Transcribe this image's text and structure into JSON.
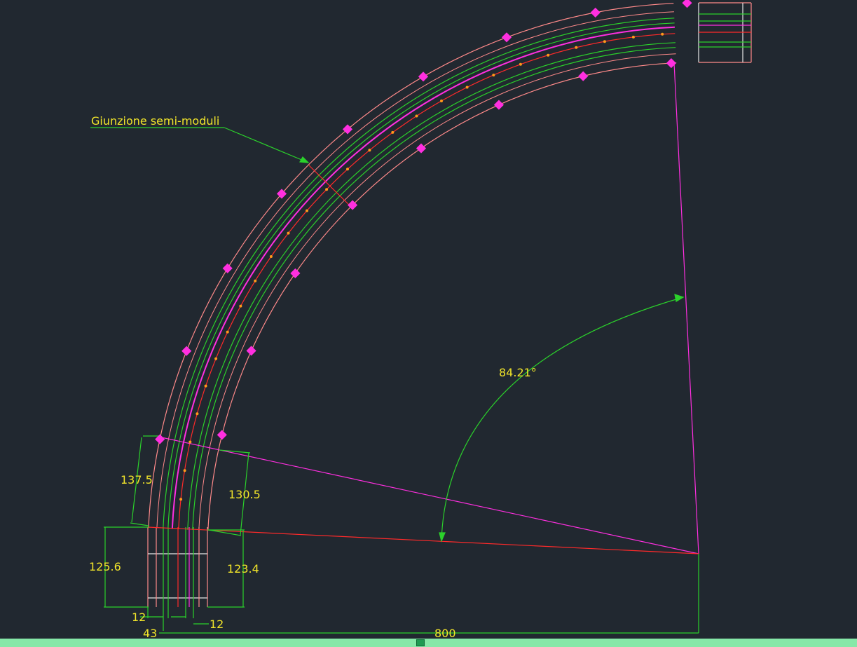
{
  "drawing": {
    "label_text": "Giunzione semi-moduli",
    "angle_label": "84.21°",
    "dimensions": {
      "left_upper": "137.5",
      "right_upper": "130.5",
      "left_lower": "125.6",
      "right_lower": "123.4",
      "bottom_left_12": "12",
      "bottom_right_12": "12",
      "bottom_43": "43",
      "bottom_800": "800"
    }
  },
  "colors": {
    "background": "#212830",
    "outer_contour": "#ff8a8a",
    "green_lines": "#2bd12b",
    "axis_red": "#ff2a2a",
    "magenta": "#ff2fe0",
    "grip_orange": "#ff9a1a",
    "dim_text": "#f2e52a",
    "status_bar": "#86e8a8"
  }
}
